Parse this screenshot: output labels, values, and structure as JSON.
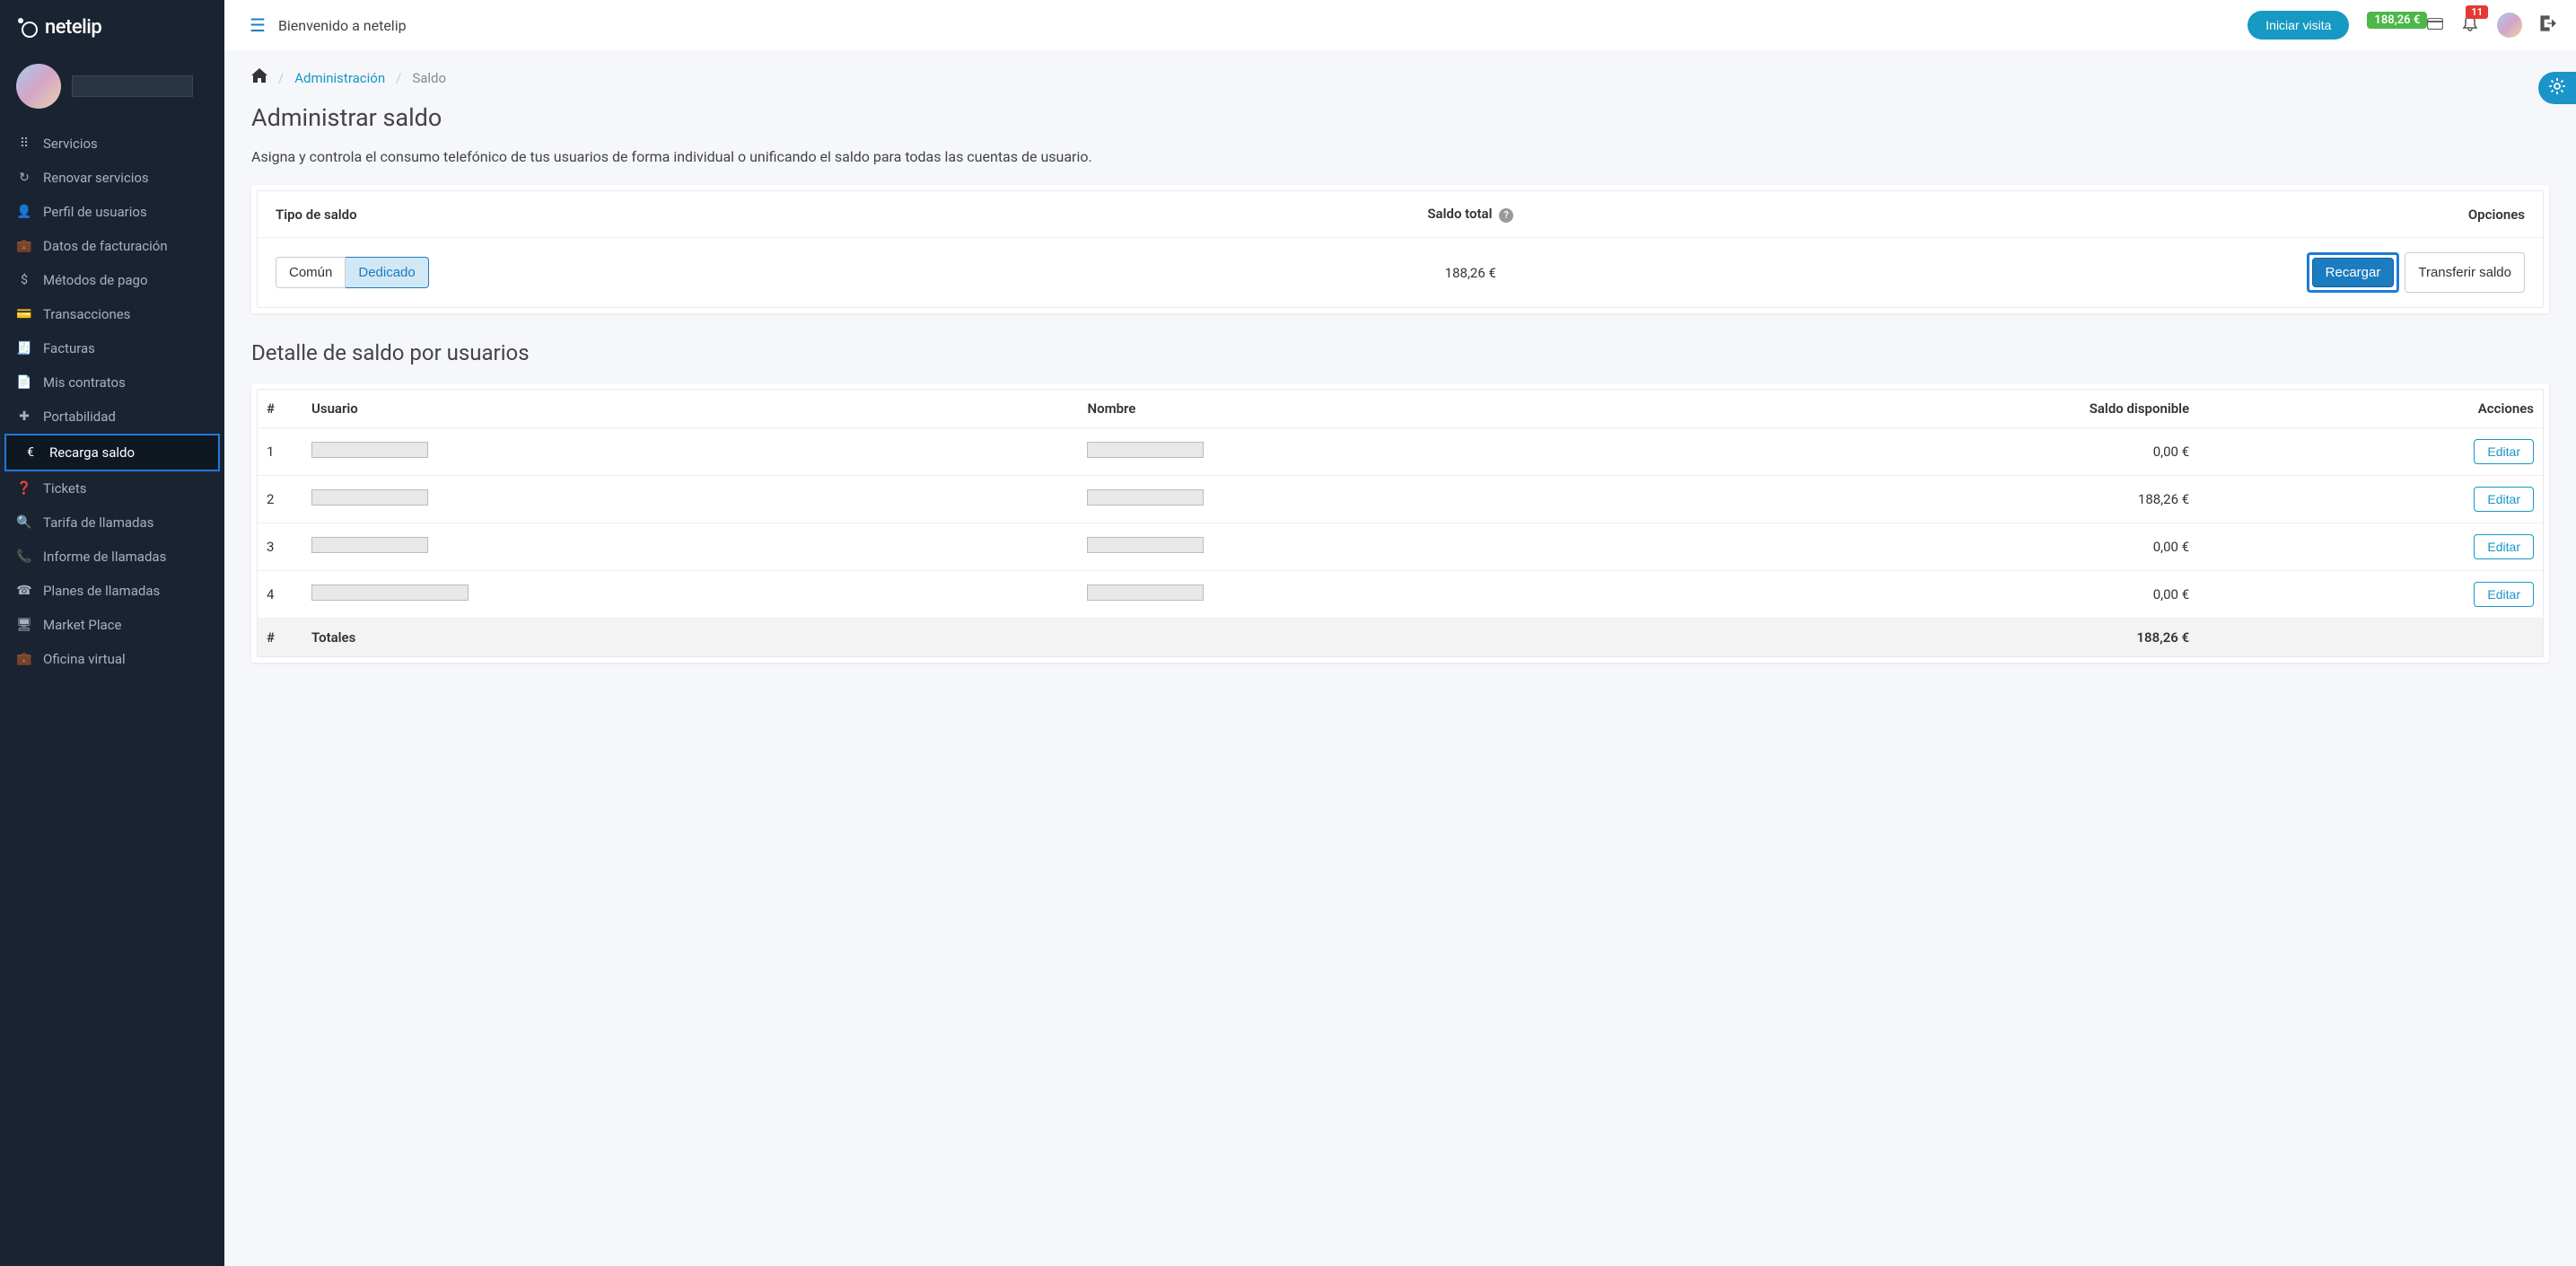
{
  "brand": "netelip",
  "topbar": {
    "welcome": "Bienvenido a netelip",
    "start_visit": "Iniciar visita",
    "balance_badge": "188,26 €",
    "notifications_count": "11"
  },
  "sidebar": {
    "items": [
      {
        "icon": "grid",
        "label": "Servicios"
      },
      {
        "icon": "refresh",
        "label": "Renovar servicios"
      },
      {
        "icon": "user",
        "label": "Perfil de usuarios"
      },
      {
        "icon": "briefcase",
        "label": "Datos de facturación"
      },
      {
        "icon": "dollar",
        "label": "Métodos de pago"
      },
      {
        "icon": "card",
        "label": "Transacciones"
      },
      {
        "icon": "doc",
        "label": "Facturas"
      },
      {
        "icon": "file",
        "label": "Mis contratos"
      },
      {
        "icon": "plus",
        "label": "Portabilidad"
      },
      {
        "icon": "euro",
        "label": "Recarga saldo"
      },
      {
        "icon": "help",
        "label": "Tickets"
      },
      {
        "icon": "search",
        "label": "Tarifa de llamadas"
      },
      {
        "icon": "phone",
        "label": "Informe de llamadas"
      },
      {
        "icon": "phone2",
        "label": "Planes de llamadas"
      },
      {
        "icon": "monitor",
        "label": "Market Place"
      },
      {
        "icon": "briefcase2",
        "label": "Oficina virtual"
      }
    ],
    "active_index": 9
  },
  "breadcrumb": {
    "admin": "Administración",
    "current": "Saldo"
  },
  "page": {
    "title": "Administrar saldo",
    "description": "Asigna y controla el consumo telefónico de tus usuarios de forma individual o unificando el saldo para todas las cuentas de usuario."
  },
  "balance_panel": {
    "headers": {
      "type": "Tipo de saldo",
      "total": "Saldo total",
      "options": "Opciones"
    },
    "type_common": "Común",
    "type_dedicated": "Dedicado",
    "total_value": "188,26 €",
    "recharge": "Recargar",
    "transfer": "Transferir saldo"
  },
  "detail": {
    "title": "Detalle de saldo por usuarios",
    "headers": {
      "num": "#",
      "user": "Usuario",
      "name": "Nombre",
      "available": "Saldo disponible",
      "actions": "Acciones"
    },
    "rows": [
      {
        "num": "1",
        "balance": "0,00 €"
      },
      {
        "num": "2",
        "balance": "188,26 €"
      },
      {
        "num": "3",
        "balance": "0,00 €"
      },
      {
        "num": "4",
        "balance": "0,00 €"
      }
    ],
    "edit_label": "Editar",
    "totals_label": "Totales",
    "totals_num": "#",
    "totals_value": "188,26 €"
  },
  "icons": {
    "grid": "⠿",
    "refresh": "↻",
    "user": "👤",
    "briefcase": "💼",
    "dollar": "$",
    "card": "💳",
    "doc": "🧾",
    "file": "📄",
    "plus": "✚",
    "euro": "€",
    "help": "❓",
    "search": "🔍",
    "phone": "📞",
    "phone2": "☎",
    "monitor": "🖥",
    "briefcase2": "💼"
  }
}
